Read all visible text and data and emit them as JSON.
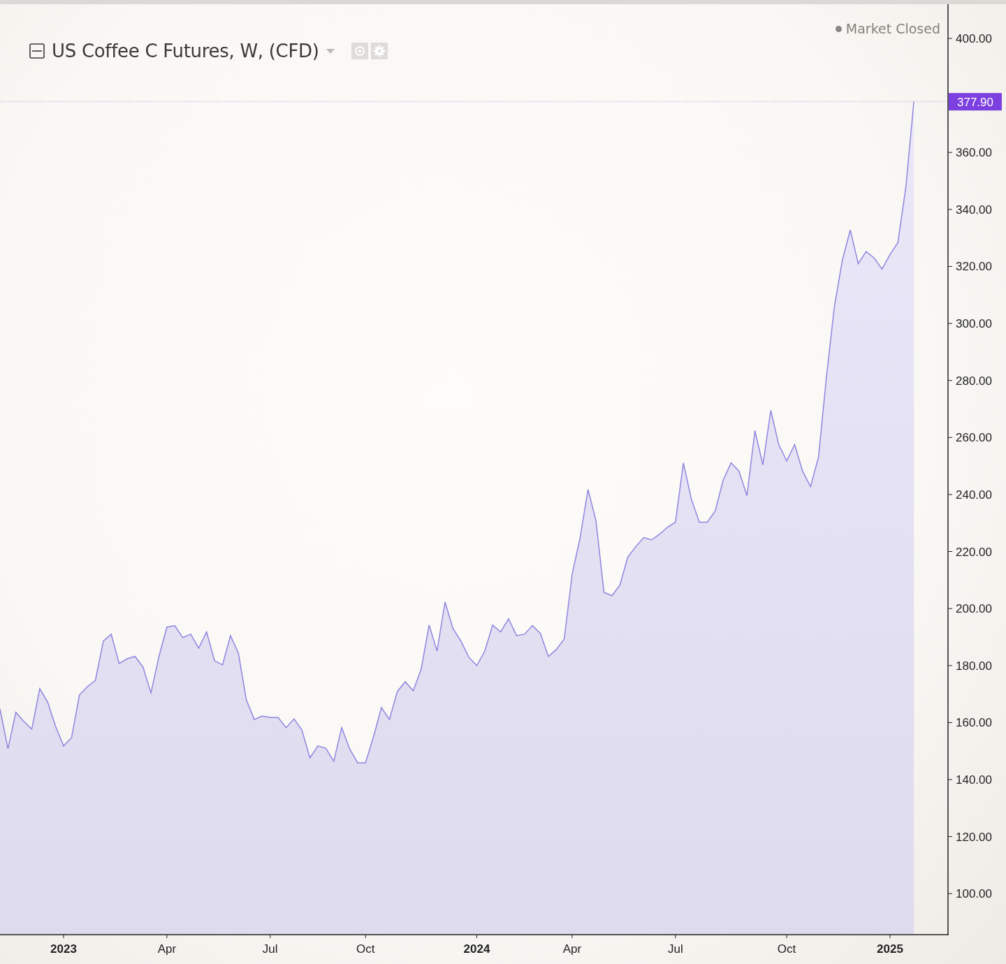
{
  "chart_header": {
    "title": "US Coffee C Futures, W, (CFD)"
  },
  "market_status": {
    "label": "Market Closed"
  },
  "chart_data": {
    "type": "area",
    "series": [
      {
        "color": "#8f86e0",
        "values": [
          164.8,
          150.8,
          163.6,
          160.4,
          157.7,
          171.9,
          167.2,
          158.6,
          151.8,
          154.7,
          169.7,
          172.6,
          174.8,
          188.6,
          191.0,
          180.7,
          182.4,
          183.2,
          179.5,
          170.4,
          183.2,
          193.5,
          194.0,
          189.8,
          191.0,
          186.1,
          191.8,
          181.7,
          180.2,
          190.5,
          184.4,
          168.0,
          161.1,
          162.3,
          161.8,
          161.8,
          158.2,
          161.3,
          157.4,
          147.6,
          151.8,
          151.0,
          146.4,
          158.2,
          150.8,
          145.9,
          145.9,
          155.0,
          165.3,
          161.1,
          170.9,
          174.3,
          171.2,
          178.8,
          194.2,
          185.1,
          202.3,
          193.0,
          188.6,
          182.9,
          180.0,
          185.1,
          194.2,
          191.8,
          196.4,
          190.5,
          191.0,
          194.0,
          191.3,
          183.2,
          185.6,
          189.3,
          212.1,
          224.9,
          241.8,
          230.8,
          205.7,
          204.5,
          208.2,
          218.0,
          221.7,
          224.9,
          224.1,
          226.1,
          228.5,
          230.3,
          251.1,
          238.4,
          230.3,
          230.3,
          234.2,
          245.0,
          251.1,
          248.2,
          239.6,
          262.4,
          250.4,
          269.5,
          257.5,
          251.8,
          257.5,
          248.2,
          242.8,
          253.1,
          281.3,
          305.8,
          322.2,
          332.8,
          321.0,
          325.2,
          323.0,
          319.1,
          324.2,
          328.4,
          348.0,
          377.9
        ]
      }
    ],
    "categories": [
      null,
      null,
      null,
      null,
      null,
      null,
      null,
      null,
      "2023",
      null,
      null,
      null,
      null,
      null,
      null,
      null,
      null,
      null,
      null,
      null,
      null,
      "Apr",
      null,
      null,
      null,
      null,
      null,
      null,
      null,
      null,
      null,
      null,
      null,
      null,
      "Jul",
      null,
      null,
      null,
      null,
      null,
      null,
      null,
      null,
      null,
      null,
      null,
      "Oct",
      null,
      null,
      null,
      null,
      null,
      null,
      null,
      null,
      null,
      null,
      null,
      null,
      null,
      "2024",
      null,
      null,
      null,
      null,
      null,
      null,
      null,
      null,
      null,
      null,
      null,
      "Apr",
      null,
      null,
      null,
      null,
      null,
      null,
      null,
      null,
      null,
      null,
      null,
      null,
      "Jul",
      null,
      null,
      null,
      null,
      null,
      null,
      null,
      null,
      null,
      null,
      null,
      null,
      null,
      "Oct",
      null,
      null,
      null,
      null,
      null,
      null,
      null,
      null,
      null,
      null,
      null,
      null,
      "2025",
      null,
      null,
      null
    ],
    "ylim": [
      85.6,
      412
    ],
    "yticks": [
      {
        "value": 100,
        "label": "100.00"
      },
      {
        "value": 120,
        "label": "120.00"
      },
      {
        "value": 140,
        "label": "140.00"
      },
      {
        "value": 160,
        "label": "160.00"
      },
      {
        "value": 180,
        "label": "180.00"
      },
      {
        "value": 200,
        "label": "200.00"
      },
      {
        "value": 220,
        "label": "220.00"
      },
      {
        "value": 240,
        "label": "240.00"
      },
      {
        "value": 260,
        "label": "260.00"
      },
      {
        "value": 280,
        "label": "280.00"
      },
      {
        "value": 300,
        "label": "300.00"
      },
      {
        "value": 320,
        "label": "320.00"
      },
      {
        "value": 340,
        "label": "340.00"
      },
      {
        "value": 360,
        "label": "360.00"
      },
      {
        "value": 400,
        "label": "400.00"
      }
    ],
    "ref_lines": [
      {
        "axis": "y",
        "value": 377.9,
        "label": "377.90"
      }
    ]
  }
}
